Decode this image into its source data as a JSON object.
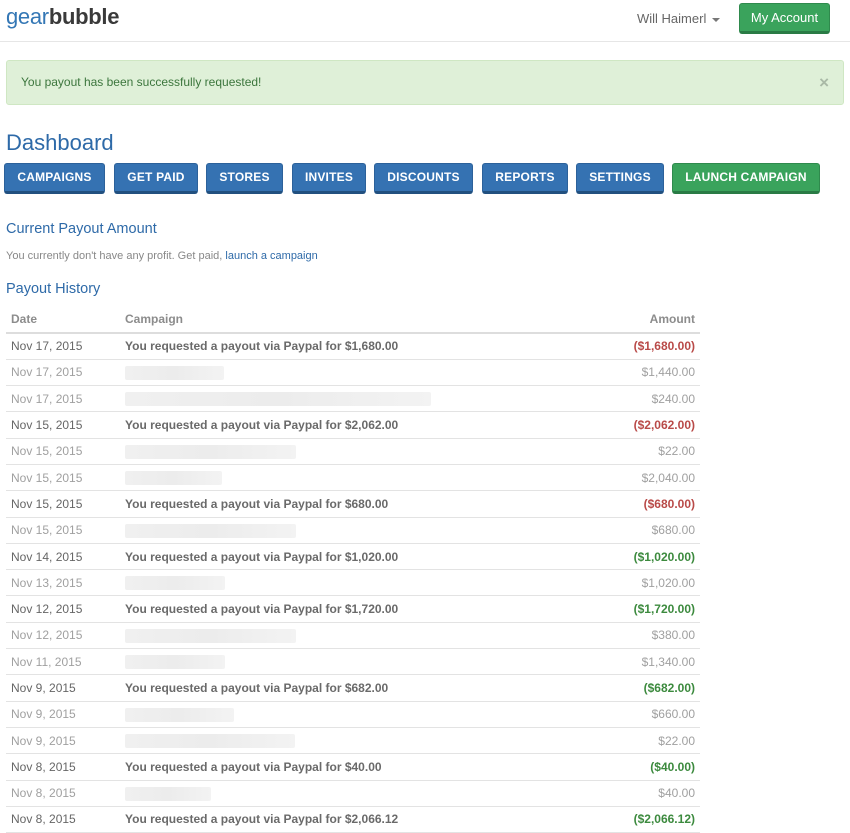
{
  "header": {
    "logo_part1": "gear",
    "logo_part2": "bubble",
    "user_name": "Will Haimerl",
    "my_account_label": "My Account"
  },
  "alert": {
    "message": "You payout has been successfully requested!",
    "close_symbol": "×"
  },
  "page_title": "Dashboard",
  "nav": [
    {
      "label": "CAMPAIGNS"
    },
    {
      "label": "GET PAID"
    },
    {
      "label": "STORES"
    },
    {
      "label": "INVITES"
    },
    {
      "label": "DISCOUNTS"
    },
    {
      "label": "REPORTS"
    },
    {
      "label": "SETTINGS"
    },
    {
      "label": "LAUNCH CAMPAIGN"
    }
  ],
  "current_payout": {
    "title": "Current Payout Amount",
    "note": "You currently don't have any profit. Get paid,",
    "link": "launch a campaign"
  },
  "payout_history": {
    "title": "Payout History",
    "columns": {
      "date": "Date",
      "campaign": "Campaign",
      "amount": "Amount"
    },
    "rows": [
      {
        "date": "Nov 17, 2015",
        "campaign": "You requested a payout via Paypal for $1,680.00",
        "amount": "($1,680.00)"
      },
      {
        "date": "Nov 17, 2015",
        "campaign": "",
        "amount": "$1,440.00"
      },
      {
        "date": "Nov 17, 2015",
        "campaign": "",
        "amount": "$240.00"
      },
      {
        "date": "Nov 15, 2015",
        "campaign": "You requested a payout via Paypal for $2,062.00",
        "amount": "($2,062.00)"
      },
      {
        "date": "Nov 15, 2015",
        "campaign": "",
        "amount": "$22.00"
      },
      {
        "date": "Nov 15, 2015",
        "campaign": "",
        "amount": "$2,040.00"
      },
      {
        "date": "Nov 15, 2015",
        "campaign": "You requested a payout via Paypal for $680.00",
        "amount": "($680.00)"
      },
      {
        "date": "Nov 15, 2015",
        "campaign": "",
        "amount": "$680.00"
      },
      {
        "date": "Nov 14, 2015",
        "campaign": "You requested a payout via Paypal for $1,020.00",
        "amount": "($1,020.00)"
      },
      {
        "date": "Nov 13, 2015",
        "campaign": "",
        "amount": "$1,020.00"
      },
      {
        "date": "Nov 12, 2015",
        "campaign": "You requested a payout via Paypal for $1,720.00",
        "amount": "($1,720.00)"
      },
      {
        "date": "Nov 12, 2015",
        "campaign": "",
        "amount": "$380.00"
      },
      {
        "date": "Nov 11, 2015",
        "campaign": "",
        "amount": "$1,340.00"
      },
      {
        "date": "Nov 9, 2015",
        "campaign": "You requested a payout via Paypal for $682.00",
        "amount": "($682.00)"
      },
      {
        "date": "Nov 9, 2015",
        "campaign": "",
        "amount": "$660.00"
      },
      {
        "date": "Nov 9, 2015",
        "campaign": "",
        "amount": "$22.00"
      },
      {
        "date": "Nov 8, 2015",
        "campaign": "You requested a payout via Paypal for $40.00",
        "amount": "($40.00)"
      },
      {
        "date": "Nov 8, 2015",
        "campaign": "",
        "amount": "$40.00"
      },
      {
        "date": "Nov 8, 2015",
        "campaign": "You requested a payout via Paypal for $2,066.12",
        "amount": "($2,066.12)"
      }
    ]
  },
  "colors": {
    "primary_blue": "#3572b2",
    "success_green": "#3aa35c",
    "negative_red": "#b94a48",
    "positive_green": "#3c8a3e",
    "alert_bg": "#dff0d8"
  }
}
